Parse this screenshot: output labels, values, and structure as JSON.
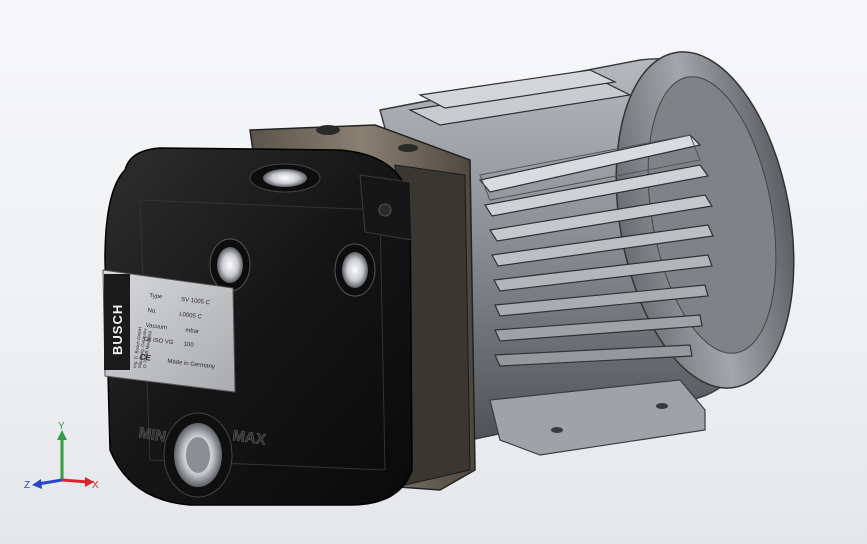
{
  "nameplate": {
    "brand": "BUSCH",
    "side_text": [
      "Ing. D. Busch GmbH",
      "Maulburg, Germany",
      "D-79689 Maulburg"
    ],
    "rows": [
      {
        "label": "Type",
        "value": "SV 1005 C"
      },
      {
        "label": "No.",
        "value": "L0005 C"
      },
      {
        "label": "Vacuum",
        "value": "mbar"
      },
      {
        "label": "Oil ISO VG",
        "value": "100"
      }
    ],
    "ce_mark": "CE",
    "made_in": "Made in Germany"
  },
  "embossed": {
    "min": "MIN",
    "max": "MAX"
  },
  "triad": {
    "x": "X",
    "y": "Y",
    "z": "Z",
    "colors": {
      "x": "#d6262b",
      "y": "#2fa043",
      "z": "#2d46c8"
    }
  },
  "colors": {
    "housing": "#1b1b1b",
    "motor": "#8c8f95",
    "background": "#f1f2f4"
  }
}
